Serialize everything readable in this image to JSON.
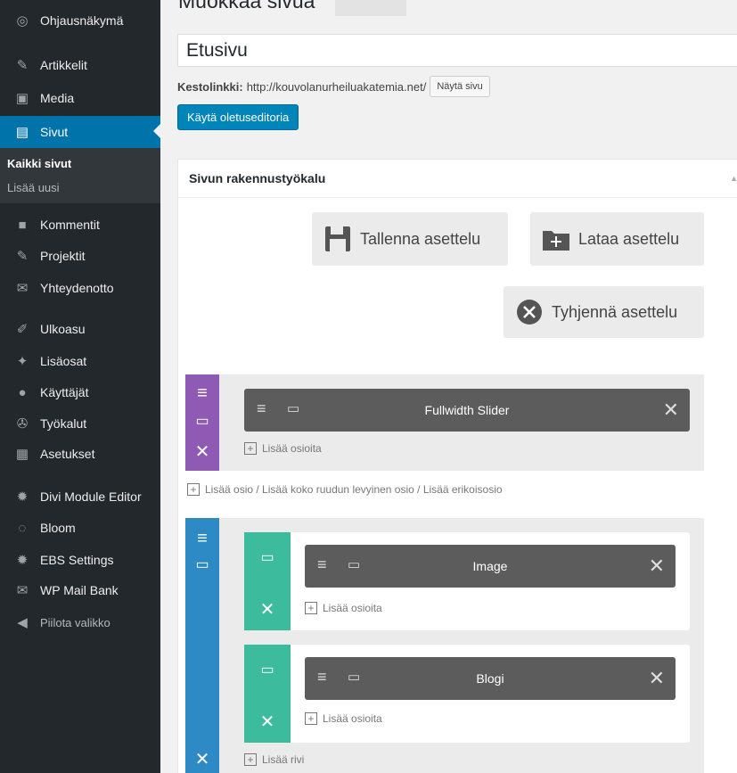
{
  "sidebar": {
    "items": [
      {
        "icon": "dashboard-icon",
        "glyph": "◎",
        "label": "Ohjausnäkymä"
      },
      {
        "icon": "pin-icon",
        "glyph": "✎",
        "label": "Artikkelit"
      },
      {
        "icon": "media-icon",
        "glyph": "▣",
        "label": "Media"
      },
      {
        "icon": "pages-icon",
        "glyph": "▤",
        "label": "Sivut"
      },
      {
        "icon": "comments-icon",
        "glyph": "■",
        "label": "Kommentit"
      },
      {
        "icon": "pin-icon",
        "glyph": "✎",
        "label": "Projektit"
      },
      {
        "icon": "mail-icon",
        "glyph": "✉",
        "label": "Yhteydenotto"
      },
      {
        "icon": "appearance-icon",
        "glyph": "✐",
        "label": "Ulkoasu"
      },
      {
        "icon": "plugins-icon",
        "glyph": "✦",
        "label": "Lisäosat"
      },
      {
        "icon": "users-icon",
        "glyph": "●",
        "label": "Käyttäjät"
      },
      {
        "icon": "tools-icon",
        "glyph": "✇",
        "label": "Työkalut"
      },
      {
        "icon": "settings-icon",
        "glyph": "▦",
        "label": "Asetukset"
      },
      {
        "icon": "gear-icon",
        "glyph": "✹",
        "label": "Divi Module Editor"
      },
      {
        "icon": "bloom-icon",
        "glyph": "◌",
        "label": "Bloom"
      },
      {
        "icon": "gear-icon",
        "glyph": "✹",
        "label": "EBS Settings"
      },
      {
        "icon": "mail-icon",
        "glyph": "✉",
        "label": "WP Mail Bank"
      },
      {
        "icon": "collapse-icon",
        "glyph": "◀",
        "label": "Piilota valikko"
      }
    ],
    "submenu": [
      "Kaikki sivut",
      "Lisää uusi"
    ]
  },
  "header": {
    "heading": "Muokkaa sivua",
    "title_value": "Etusivu",
    "permalink_label": "Kestolinkki:",
    "permalink_url": "http://kouvolanurheiluakatemia.net/",
    "view_page": "Näytä sivu",
    "default_editor": "Käytä oletuseditoria"
  },
  "builder": {
    "title": "Sivun rakennustyökalu",
    "save_layout": "Tallenna asettelu",
    "load_layout": "Lataa asettelu",
    "clear_layout": "Tyhjennä asettelu",
    "add_modules": "Lisää osioita",
    "add_section_links": "Lisää osio / Lisää koko ruudun levyinen osio / Lisää erikoisosio",
    "add_row": "Lisää rivi",
    "modules": {
      "fullwidth_slider": "Fullwidth Slider",
      "image": "Image",
      "blog": "Blogi"
    }
  },
  "colors": {
    "sidebar_bg": "#23282d",
    "active_blue": "#0073aa",
    "specialty_purple": "#8e5ab3",
    "section_blue": "#2e8ac5",
    "row_teal": "#3dbb9d"
  }
}
